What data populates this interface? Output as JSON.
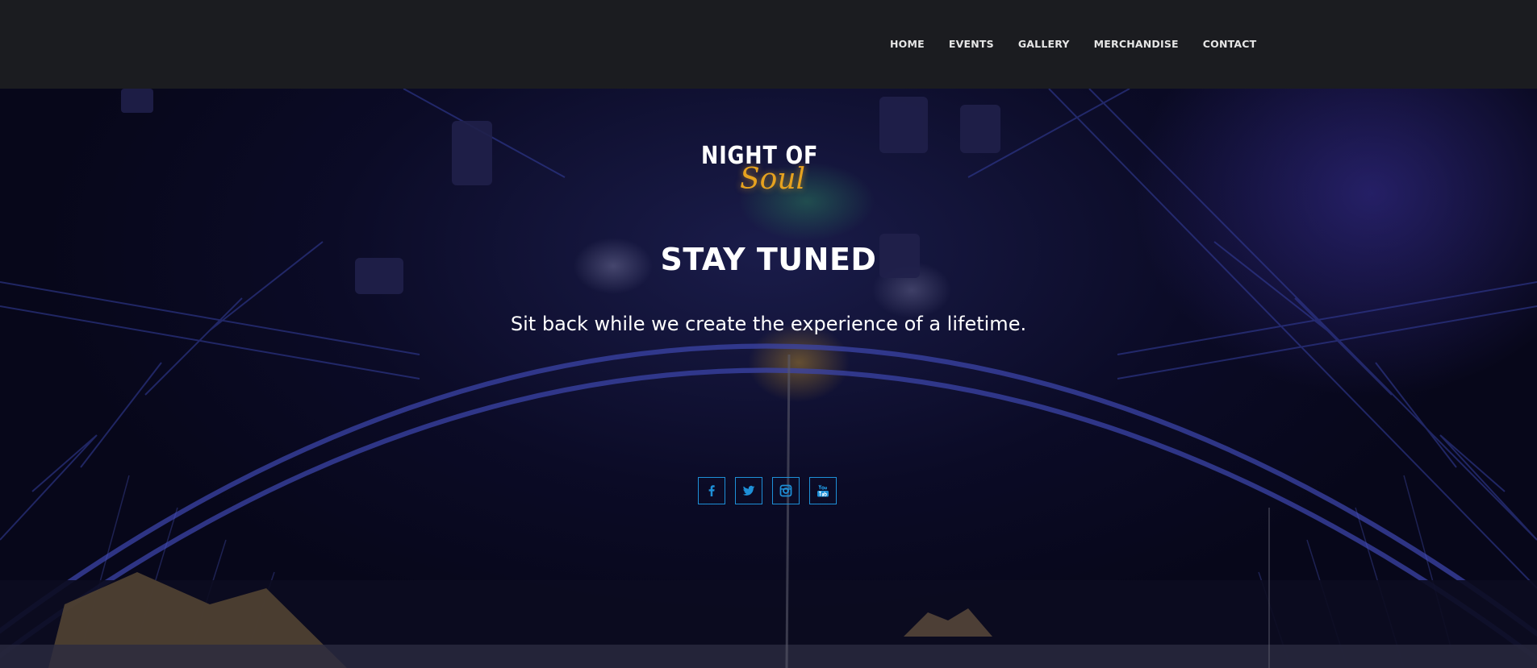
{
  "nav": {
    "items": [
      {
        "label": "HOME"
      },
      {
        "label": "EVENTS"
      },
      {
        "label": "GALLERY"
      },
      {
        "label": "MERCHANDISE"
      },
      {
        "label": "CONTACT"
      }
    ]
  },
  "hero": {
    "logo": {
      "line1": "NIGHT OF",
      "line2": "Soul"
    },
    "title": "STAY TUNED",
    "subtitle": "Sit back while we create the experience of a lifetime."
  },
  "social": {
    "icons": [
      "facebook-icon",
      "twitter-icon",
      "instagram-icon",
      "youtube-icon"
    ]
  },
  "colors": {
    "navbar_bg": "#1b1c20",
    "social_accent": "#1e90d8",
    "logo_accent": "#e6a21f"
  }
}
